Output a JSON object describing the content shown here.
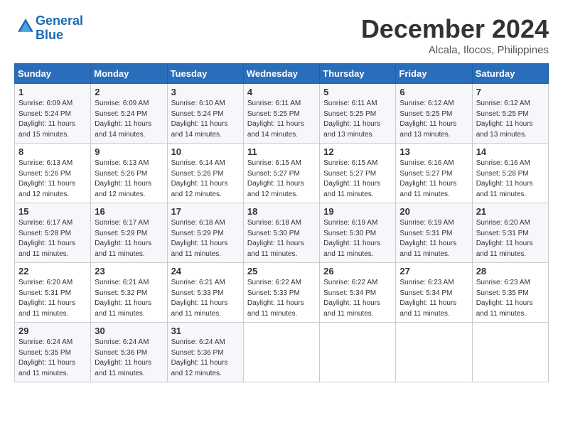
{
  "logo": {
    "line1": "General",
    "line2": "Blue"
  },
  "title": "December 2024",
  "location": "Alcala, Ilocos, Philippines",
  "days_of_week": [
    "Sunday",
    "Monday",
    "Tuesday",
    "Wednesday",
    "Thursday",
    "Friday",
    "Saturday"
  ],
  "weeks": [
    [
      {
        "day": 1,
        "sunrise": "6:09 AM",
        "sunset": "5:24 PM",
        "daylight": "11 hours and 15 minutes."
      },
      {
        "day": 2,
        "sunrise": "6:09 AM",
        "sunset": "5:24 PM",
        "daylight": "11 hours and 14 minutes."
      },
      {
        "day": 3,
        "sunrise": "6:10 AM",
        "sunset": "5:24 PM",
        "daylight": "11 hours and 14 minutes."
      },
      {
        "day": 4,
        "sunrise": "6:11 AM",
        "sunset": "5:25 PM",
        "daylight": "11 hours and 14 minutes."
      },
      {
        "day": 5,
        "sunrise": "6:11 AM",
        "sunset": "5:25 PM",
        "daylight": "11 hours and 13 minutes."
      },
      {
        "day": 6,
        "sunrise": "6:12 AM",
        "sunset": "5:25 PM",
        "daylight": "11 hours and 13 minutes."
      },
      {
        "day": 7,
        "sunrise": "6:12 AM",
        "sunset": "5:25 PM",
        "daylight": "11 hours and 13 minutes."
      }
    ],
    [
      {
        "day": 8,
        "sunrise": "6:13 AM",
        "sunset": "5:26 PM",
        "daylight": "11 hours and 12 minutes."
      },
      {
        "day": 9,
        "sunrise": "6:13 AM",
        "sunset": "5:26 PM",
        "daylight": "11 hours and 12 minutes."
      },
      {
        "day": 10,
        "sunrise": "6:14 AM",
        "sunset": "5:26 PM",
        "daylight": "11 hours and 12 minutes."
      },
      {
        "day": 11,
        "sunrise": "6:15 AM",
        "sunset": "5:27 PM",
        "daylight": "11 hours and 12 minutes."
      },
      {
        "day": 12,
        "sunrise": "6:15 AM",
        "sunset": "5:27 PM",
        "daylight": "11 hours and 11 minutes."
      },
      {
        "day": 13,
        "sunrise": "6:16 AM",
        "sunset": "5:27 PM",
        "daylight": "11 hours and 11 minutes."
      },
      {
        "day": 14,
        "sunrise": "6:16 AM",
        "sunset": "5:28 PM",
        "daylight": "11 hours and 11 minutes."
      }
    ],
    [
      {
        "day": 15,
        "sunrise": "6:17 AM",
        "sunset": "5:28 PM",
        "daylight": "11 hours and 11 minutes."
      },
      {
        "day": 16,
        "sunrise": "6:17 AM",
        "sunset": "5:29 PM",
        "daylight": "11 hours and 11 minutes."
      },
      {
        "day": 17,
        "sunrise": "6:18 AM",
        "sunset": "5:29 PM",
        "daylight": "11 hours and 11 minutes."
      },
      {
        "day": 18,
        "sunrise": "6:18 AM",
        "sunset": "5:30 PM",
        "daylight": "11 hours and 11 minutes."
      },
      {
        "day": 19,
        "sunrise": "6:19 AM",
        "sunset": "5:30 PM",
        "daylight": "11 hours and 11 minutes."
      },
      {
        "day": 20,
        "sunrise": "6:19 AM",
        "sunset": "5:31 PM",
        "daylight": "11 hours and 11 minutes."
      },
      {
        "day": 21,
        "sunrise": "6:20 AM",
        "sunset": "5:31 PM",
        "daylight": "11 hours and 11 minutes."
      }
    ],
    [
      {
        "day": 22,
        "sunrise": "6:20 AM",
        "sunset": "5:31 PM",
        "daylight": "11 hours and 11 minutes."
      },
      {
        "day": 23,
        "sunrise": "6:21 AM",
        "sunset": "5:32 PM",
        "daylight": "11 hours and 11 minutes."
      },
      {
        "day": 24,
        "sunrise": "6:21 AM",
        "sunset": "5:33 PM",
        "daylight": "11 hours and 11 minutes."
      },
      {
        "day": 25,
        "sunrise": "6:22 AM",
        "sunset": "5:33 PM",
        "daylight": "11 hours and 11 minutes."
      },
      {
        "day": 26,
        "sunrise": "6:22 AM",
        "sunset": "5:34 PM",
        "daylight": "11 hours and 11 minutes."
      },
      {
        "day": 27,
        "sunrise": "6:23 AM",
        "sunset": "5:34 PM",
        "daylight": "11 hours and 11 minutes."
      },
      {
        "day": 28,
        "sunrise": "6:23 AM",
        "sunset": "5:35 PM",
        "daylight": "11 hours and 11 minutes."
      }
    ],
    [
      {
        "day": 29,
        "sunrise": "6:24 AM",
        "sunset": "5:35 PM",
        "daylight": "11 hours and 11 minutes."
      },
      {
        "day": 30,
        "sunrise": "6:24 AM",
        "sunset": "5:36 PM",
        "daylight": "11 hours and 11 minutes."
      },
      {
        "day": 31,
        "sunrise": "6:24 AM",
        "sunset": "5:36 PM",
        "daylight": "11 hours and 12 minutes."
      },
      null,
      null,
      null,
      null
    ]
  ]
}
